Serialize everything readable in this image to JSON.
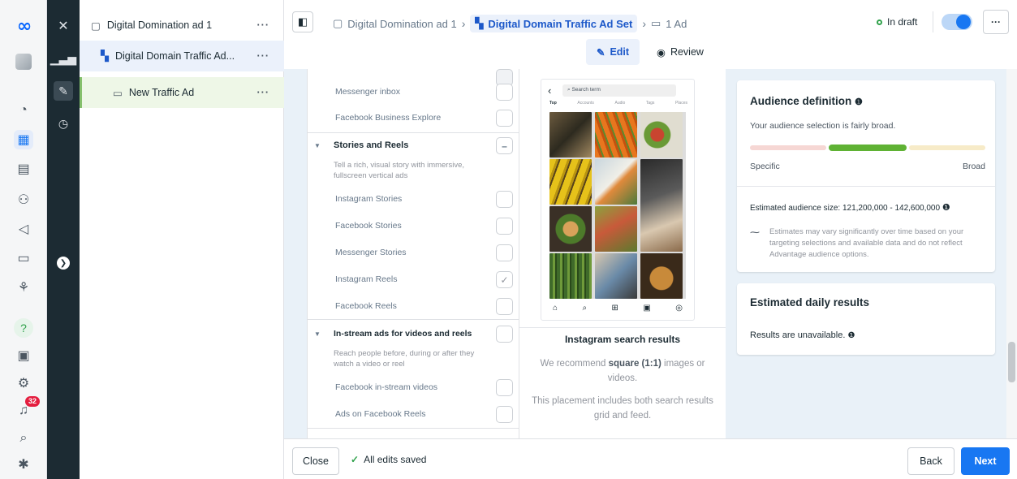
{
  "rail": {
    "logo": "∞",
    "notifications_badge": "32"
  },
  "tree": {
    "items": [
      {
        "label": "Digital Domination ad 1",
        "more": "···"
      },
      {
        "label": "Digital Domain Traffic Ad...",
        "more": "···"
      },
      {
        "label": "New Traffic Ad",
        "more": "···"
      }
    ]
  },
  "topbar": {
    "breadcrumb": [
      "Digital Domination ad 1",
      "Digital Domain Traffic Ad Set",
      "1 Ad"
    ],
    "status": "In draft",
    "more": "···",
    "edit_tab": "Edit",
    "review_tab": "Review"
  },
  "placements": {
    "top_items": [
      "Messenger inbox",
      "Facebook Business Explore"
    ],
    "stories_group": {
      "title": "Stories and Reels",
      "desc": "Tell a rich, visual story with immersive, fullscreen vertical ads",
      "items": [
        "Instagram Stories",
        "Facebook Stories",
        "Messenger Stories",
        "Instagram Reels",
        "Facebook Reels"
      ]
    },
    "instream_group": {
      "title": "In-stream ads for videos and reels",
      "desc": "Reach people before, during or after they watch a video or reel",
      "items": [
        "Facebook in-stream videos",
        "Ads on Facebook Reels"
      ]
    }
  },
  "preview": {
    "search_placeholder": "Search term",
    "tabs": [
      "Top",
      "Accounts",
      "Audio",
      "Tags",
      "Places"
    ],
    "title": "Instagram search results",
    "recommend_pre": "We recommend ",
    "recommend_bold": "square (1:1)",
    "recommend_post": " images or videos.",
    "note": "This placement includes both search results grid and feed."
  },
  "audience": {
    "title": "Audience definition",
    "subtitle": "Your audience selection is fairly broad.",
    "specific": "Specific",
    "broad": "Broad",
    "size": "Estimated audience size: 121,200,000 - 142,600,000",
    "estimates": "Estimates may vary significantly over time based on your targeting selections and available data and do not reflect Advantage audience options."
  },
  "daily": {
    "title": "Estimated daily results",
    "text": "Results are unavailable."
  },
  "bottom": {
    "close": "Close",
    "saved": "All edits saved",
    "back": "Back",
    "next": "Next"
  },
  "colors": {
    "accent": "#1877f2",
    "saved_green": "#31a24c",
    "gauge_specific": "#f6d7d4",
    "gauge_mid": "#5fb234",
    "gauge_broad": "#f7ebc8"
  }
}
